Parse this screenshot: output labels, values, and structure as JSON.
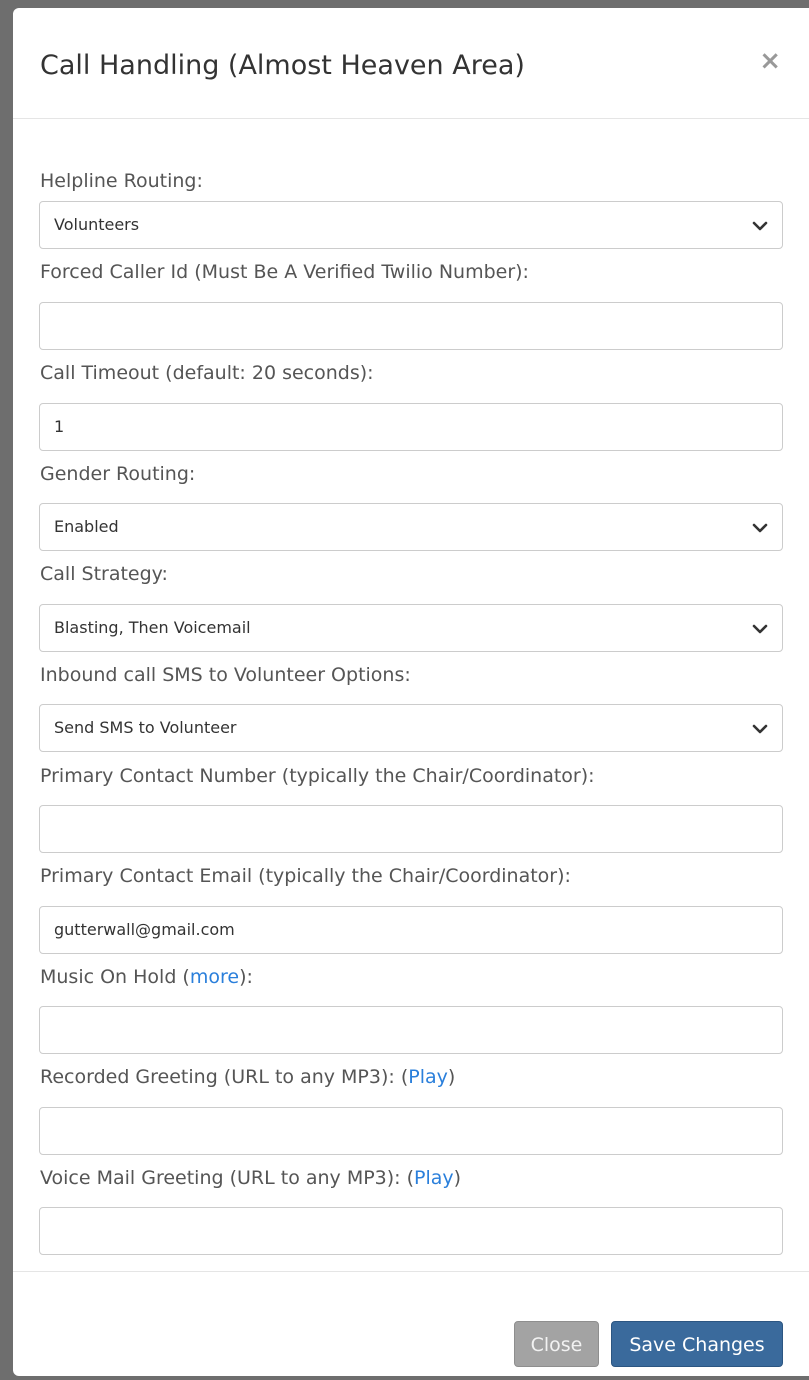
{
  "modal": {
    "title": "Call Handling (Almost Heaven Area)",
    "close_symbol": "×"
  },
  "fields": {
    "helpline_routing": {
      "label": "Helpline Routing:",
      "value": "Volunteers"
    },
    "forced_caller_id": {
      "label": "Forced Caller Id (Must Be A Verified Twilio Number):",
      "value": ""
    },
    "call_timeout": {
      "label": "Call Timeout (default: 20 seconds):",
      "value": "1"
    },
    "gender_routing": {
      "label": "Gender Routing:",
      "value": "Enabled"
    },
    "call_strategy": {
      "label": "Call Strategy:",
      "value": "Blasting, Then Voicemail"
    },
    "inbound_sms": {
      "label": "Inbound call SMS to Volunteer Options:",
      "value": "Send SMS to Volunteer"
    },
    "primary_contact_number": {
      "label": "Primary Contact Number (typically the Chair/Coordinator):",
      "value": ""
    },
    "primary_contact_email": {
      "label": "Primary Contact Email (typically the Chair/Coordinator):",
      "value": "gutterwall@gmail.com"
    },
    "music_on_hold": {
      "label_prefix": "Music On Hold (",
      "link": "more",
      "label_suffix": "):",
      "value": ""
    },
    "recorded_greeting": {
      "label_prefix": "Recorded Greeting (URL to any MP3): (",
      "link": "Play",
      "label_suffix": ")",
      "value": ""
    },
    "voicemail_greeting": {
      "label_prefix": "Voice Mail Greeting (URL to any MP3): (",
      "link": "Play",
      "label_suffix": ")",
      "value": ""
    }
  },
  "footer": {
    "close_label": "Close",
    "save_label": "Save Changes"
  },
  "icons": {
    "select_indicator": "chevron-down-icon",
    "dismiss": "close-icon"
  },
  "colors": {
    "link": "#2a7fdb",
    "primary_button": "#3a6a9c",
    "secondary_button": "#a3a3a3"
  }
}
